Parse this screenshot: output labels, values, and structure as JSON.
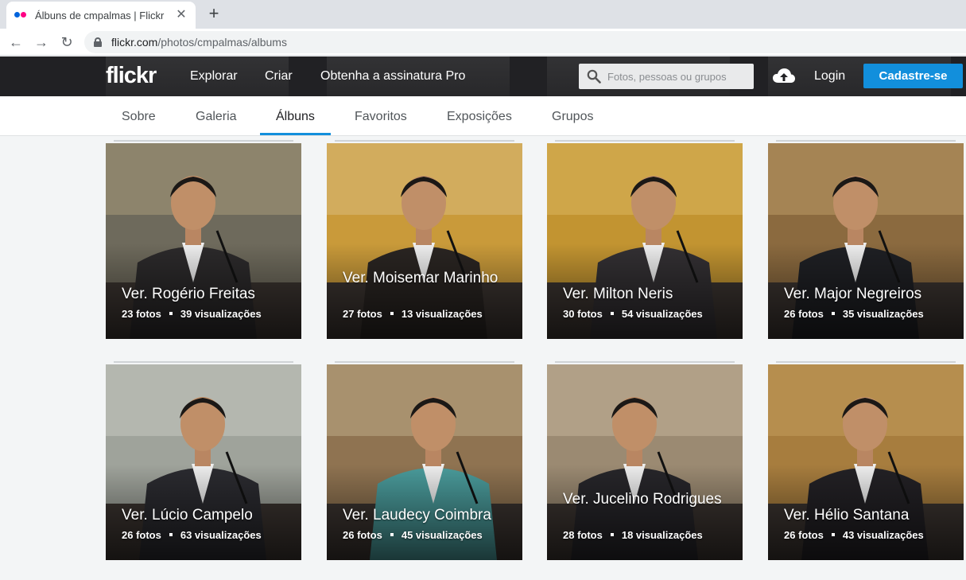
{
  "browser": {
    "tab_title": "Álbuns de cmpalmas | Flickr",
    "url_host": "flickr.com",
    "url_path": "/photos/cmpalmas/albums"
  },
  "header": {
    "logo": "flickr",
    "nav": [
      "Explorar",
      "Criar",
      "Obtenha a assinatura Pro"
    ],
    "search_placeholder": "Fotos, pessoas ou grupos",
    "login": "Login",
    "signup": "Cadastre-se"
  },
  "subnav": {
    "items": [
      "Sobre",
      "Galeria",
      "Álbuns",
      "Favoritos",
      "Exposições",
      "Grupos"
    ],
    "active": "Álbuns"
  },
  "albums": [
    {
      "title": "Ver. Rogério Freitas",
      "photos": "23 fotos",
      "views": "39 visualizações",
      "colors": [
        "#6e6a5c",
        "#2c2a2b",
        "#c9b48a"
      ]
    },
    {
      "title": "Ver. Moisemar Marinho",
      "photos": "27 fotos",
      "views": "13 visualizações",
      "colors": [
        "#c99a3a",
        "#2a2522",
        "#e3cfa0"
      ]
    },
    {
      "title": "Ver. Milton Neris",
      "photos": "30 fotos",
      "views": "54 visualizações",
      "colors": [
        "#c29431",
        "#333033",
        "#e8c877"
      ]
    },
    {
      "title": "Ver. Major Negreiros",
      "photos": "26 fotos",
      "views": "35 visualizações",
      "colors": [
        "#8b6a3f",
        "#1f2024",
        "#d7b47a"
      ]
    },
    {
      "title": "Ver. Lúcio Campelo",
      "photos": "26 fotos",
      "views": "63 visualizações",
      "colors": [
        "#9fa39b",
        "#2b2b30",
        "#dcdcd4"
      ]
    },
    {
      "title": "Ver. Laudecy Coimbra",
      "photos": "26 fotos",
      "views": "45 visualizações",
      "colors": [
        "#8f7351",
        "#4a9b9b",
        "#d8c9a7"
      ]
    },
    {
      "title": "Ver. Jucelino Rodrigues",
      "photos": "28 fotos",
      "views": "18 visualizações",
      "colors": [
        "#9b8a72",
        "#27262a",
        "#d9c8ae"
      ]
    },
    {
      "title": "Ver. Hélio Santana",
      "photos": "26 fotos",
      "views": "43 visualizações",
      "colors": [
        "#a77d3e",
        "#232125",
        "#d5ae6c"
      ]
    }
  ]
}
